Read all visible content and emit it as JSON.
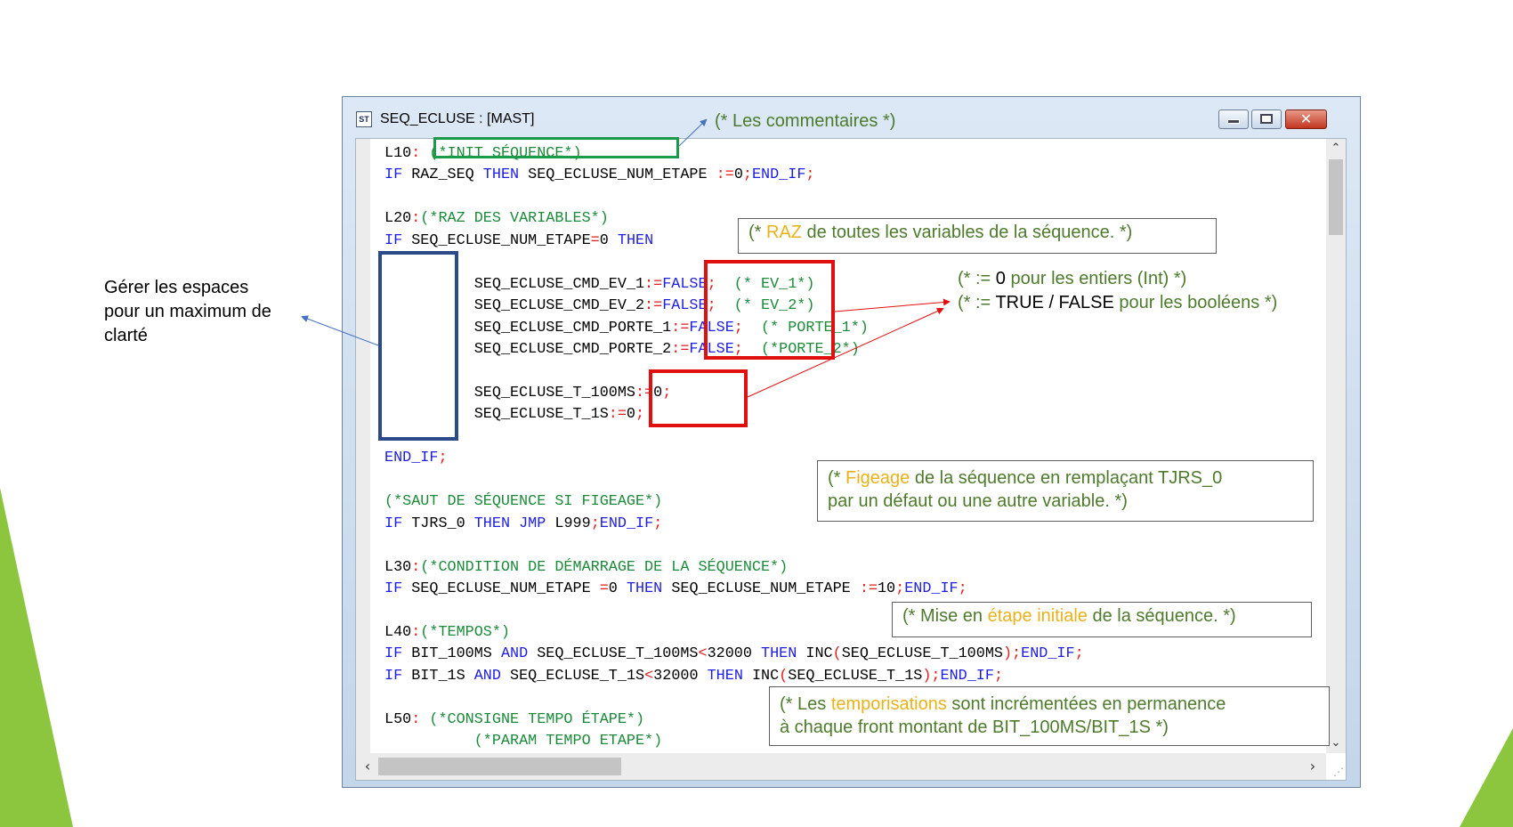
{
  "colors": {
    "keyword": "#1e1ee0",
    "operator": "#e01e1e",
    "comment": "#1c8a3a",
    "note_text": "#4e7a2c",
    "note_highlight": "#eab21a",
    "box_green": "#1a9a4a",
    "box_red": "#e01010",
    "box_blue": "#2a4a8a",
    "slide_accent": "#8cc63f"
  },
  "window": {
    "title": "SEQ_ECLUSE : [MAST]",
    "icon": "st-app-icon",
    "controls": [
      "minimize-icon",
      "maximize-icon",
      "close-icon"
    ]
  },
  "code": [
    [
      [
        "n",
        "L10"
      ],
      [
        "o",
        ":"
      ],
      [
        "n",
        " "
      ],
      [
        "c",
        "(*INIT SÉQUENCE*)"
      ]
    ],
    [
      [
        "k",
        "IF"
      ],
      [
        "n",
        " RAZ_SEQ "
      ],
      [
        "k",
        "THEN"
      ],
      [
        "n",
        " SEQ_ECLUSE_NUM_ETAPE "
      ],
      [
        "o",
        ":="
      ],
      [
        "n",
        "0"
      ],
      [
        "o",
        ";"
      ],
      [
        "k",
        "END_IF"
      ],
      [
        "o",
        ";"
      ]
    ],
    [],
    [
      [
        "n",
        "L20"
      ],
      [
        "o",
        ":"
      ],
      [
        "c",
        "(*RAZ DES VARIABLES*)"
      ]
    ],
    [
      [
        "k",
        "IF"
      ],
      [
        "n",
        " SEQ_ECLUSE_NUM_ETAPE"
      ],
      [
        "o",
        "="
      ],
      [
        "n",
        "0 "
      ],
      [
        "k",
        "THEN"
      ]
    ],
    [],
    [
      [
        "n",
        "          SEQ_ECLUSE_CMD_EV_1"
      ],
      [
        "o",
        ":="
      ],
      [
        "k",
        "FALSE"
      ],
      [
        "o",
        ";"
      ],
      [
        "n",
        "  "
      ],
      [
        "c",
        "(* EV_1*)"
      ]
    ],
    [
      [
        "n",
        "          SEQ_ECLUSE_CMD_EV_2"
      ],
      [
        "o",
        ":="
      ],
      [
        "k",
        "FALSE"
      ],
      [
        "o",
        ";"
      ],
      [
        "n",
        "  "
      ],
      [
        "c",
        "(* EV_2*)"
      ]
    ],
    [
      [
        "n",
        "          SEQ_ECLUSE_CMD_PORTE_1"
      ],
      [
        "o",
        ":="
      ],
      [
        "k",
        "FALSE"
      ],
      [
        "o",
        ";"
      ],
      [
        "n",
        "  "
      ],
      [
        "c",
        "(* PORTE_1*)"
      ]
    ],
    [
      [
        "n",
        "          SEQ_ECLUSE_CMD_PORTE_2"
      ],
      [
        "o",
        ":="
      ],
      [
        "k",
        "FALSE"
      ],
      [
        "o",
        ";"
      ],
      [
        "n",
        "  "
      ],
      [
        "c",
        "(*PORTE_2*)"
      ]
    ],
    [],
    [
      [
        "n",
        "          SEQ_ECLUSE_T_100MS"
      ],
      [
        "o",
        ":="
      ],
      [
        "n",
        "0"
      ],
      [
        "o",
        ";"
      ]
    ],
    [
      [
        "n",
        "          SEQ_ECLUSE_T_1S"
      ],
      [
        "o",
        ":="
      ],
      [
        "n",
        "0"
      ],
      [
        "o",
        ";"
      ]
    ],
    [],
    [
      [
        "k",
        "END_IF"
      ],
      [
        "o",
        ";"
      ]
    ],
    [],
    [
      [
        "c",
        "(*SAUT DE SÉQUENCE SI FIGEAGE*)"
      ]
    ],
    [
      [
        "k",
        "IF"
      ],
      [
        "n",
        " TJRS_0 "
      ],
      [
        "k",
        "THEN"
      ],
      [
        "n",
        " "
      ],
      [
        "k",
        "JMP"
      ],
      [
        "n",
        " L999"
      ],
      [
        "o",
        ";"
      ],
      [
        "k",
        "END_IF"
      ],
      [
        "o",
        ";"
      ]
    ],
    [],
    [
      [
        "n",
        "L30"
      ],
      [
        "o",
        ":"
      ],
      [
        "c",
        "(*CONDITION DE DÉMARRAGE DE LA SÉQUENCE*)"
      ]
    ],
    [
      [
        "k",
        "IF"
      ],
      [
        "n",
        " SEQ_ECLUSE_NUM_ETAPE "
      ],
      [
        "o",
        "="
      ],
      [
        "n",
        "0 "
      ],
      [
        "k",
        "THEN"
      ],
      [
        "n",
        " SEQ_ECLUSE_NUM_ETAPE "
      ],
      [
        "o",
        ":="
      ],
      [
        "n",
        "10"
      ],
      [
        "o",
        ";"
      ],
      [
        "k",
        "END_IF"
      ],
      [
        "o",
        ";"
      ]
    ],
    [],
    [
      [
        "n",
        "L40"
      ],
      [
        "o",
        ":"
      ],
      [
        "c",
        "(*TEMPOS*)"
      ]
    ],
    [
      [
        "k",
        "IF"
      ],
      [
        "n",
        " BIT_100MS "
      ],
      [
        "k",
        "AND"
      ],
      [
        "n",
        " SEQ_ECLUSE_T_100MS"
      ],
      [
        "o",
        "<"
      ],
      [
        "n",
        "32000 "
      ],
      [
        "k",
        "THEN"
      ],
      [
        "n",
        " INC"
      ],
      [
        "o",
        "("
      ],
      [
        "n",
        "SEQ_ECLUSE_T_100MS"
      ],
      [
        "o",
        ");"
      ],
      [
        "k",
        "END_IF"
      ],
      [
        "o",
        ";"
      ]
    ],
    [
      [
        "k",
        "IF"
      ],
      [
        "n",
        " BIT_1S "
      ],
      [
        "k",
        "AND"
      ],
      [
        "n",
        " SEQ_ECLUSE_T_1S"
      ],
      [
        "o",
        "<"
      ],
      [
        "n",
        "32000 "
      ],
      [
        "k",
        "THEN"
      ],
      [
        "n",
        " INC"
      ],
      [
        "o",
        "("
      ],
      [
        "n",
        "SEQ_ECLUSE_T_1S"
      ],
      [
        "o",
        ");"
      ],
      [
        "k",
        "END_IF"
      ],
      [
        "o",
        ";"
      ]
    ],
    [],
    [
      [
        "n",
        "L50"
      ],
      [
        "o",
        ":"
      ],
      [
        "n",
        " "
      ],
      [
        "c",
        "(*CONSIGNE TEMPO ÉTAPE*)"
      ]
    ],
    [
      [
        "n",
        "          "
      ],
      [
        "c",
        "(*PARAM TEMPO ETAPE*)"
      ]
    ]
  ],
  "annotations": {
    "comments": "(* Les commentaires *)",
    "raz": {
      "a": "(* ",
      "hl": "RAZ",
      "b": " de toutes les variables de la séquence. *)"
    },
    "int": {
      "a": "(* := ",
      "num": "0",
      "b": " pour les entiers (Int) *)"
    },
    "bool": {
      "a": "(* := ",
      "vals": "TRUE / FALSE",
      "b": " pour les booléens *)"
    },
    "figeage": {
      "a": "(* ",
      "hl": "Figeage",
      "b": " de la séquence en remplaçant TJRS_0",
      "line2": "par un défaut ou une autre variable. *)"
    },
    "etape": {
      "a": "(* Mise en ",
      "hl": "étape initiale",
      "b": " de la séquence. *)"
    },
    "tempo": {
      "a": "(* Les ",
      "hl": "temporisations",
      "b": " sont incrémentées en permanence",
      "line2": "à chaque front montant de BIT_100MS/BIT_1S *)"
    },
    "spaces": "Gérer les espaces pour un maximum de clarté"
  }
}
